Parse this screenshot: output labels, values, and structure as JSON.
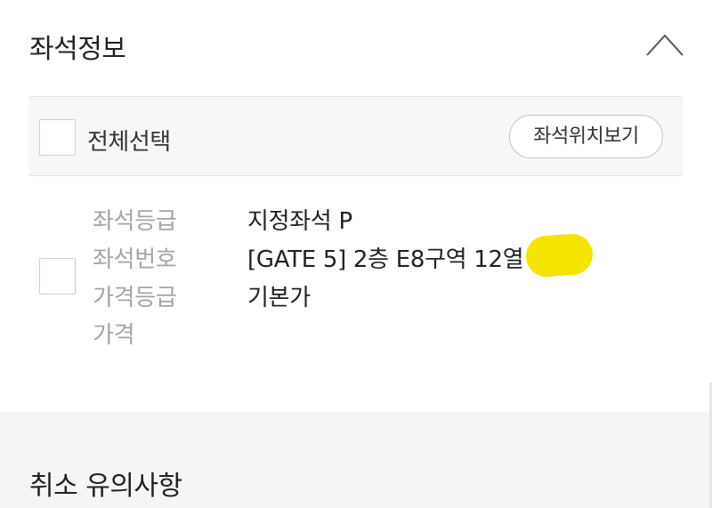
{
  "seat_info": {
    "title": "좌석정보",
    "collapse_icon": "chevron-up-icon"
  },
  "select_bar": {
    "select_all_label": "전체선택",
    "view_seat_location_label": "좌석위치보기"
  },
  "seat": {
    "labels": {
      "grade": "좌석등급",
      "number": "좌석번호",
      "price_grade": "가격등급",
      "price": "가격"
    },
    "values": {
      "grade": "지정좌석 P",
      "number": "[GATE 5] 2층 E8구역 12열",
      "price_grade": "기본가",
      "price": ""
    },
    "highlight_color": "#f5e300"
  },
  "cancel_notice": {
    "title": "취소 유의사항"
  }
}
